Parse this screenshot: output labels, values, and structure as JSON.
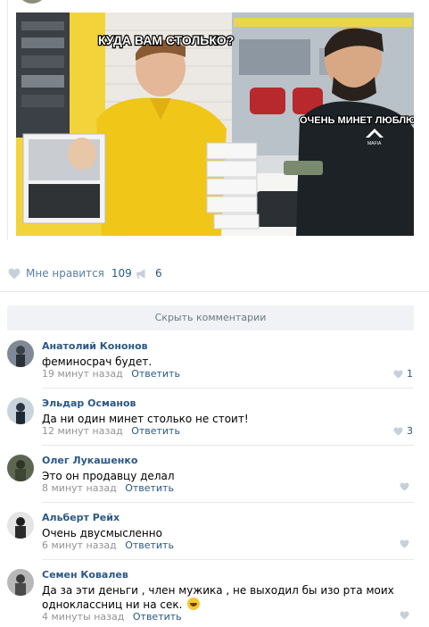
{
  "post": {
    "image_captions": {
      "top": "КУДА ВАМ СТОЛЬКО?",
      "right": "ОЧЕНЬ МИНЕТ ЛЮБЛЮ",
      "brand": "MAFIA"
    }
  },
  "actions": {
    "like_label": "Мне нравится",
    "like_count": "109",
    "share_count": "6"
  },
  "hide_comments_label": "Скрыть комментарии",
  "comments": [
    {
      "author": "Анатолий Кононов",
      "text": "феминосрач будет.",
      "time": "19 минут назад",
      "reply": "Ответить",
      "likes": "1"
    },
    {
      "author": "Эльдар Османов",
      "text": "Да ни один минет столько не стоит!",
      "time": "12 минут назад",
      "reply": "Ответить",
      "likes": "3"
    },
    {
      "author": "Олег Лукашенко",
      "text": "Это он продавцу делал",
      "time": "8 минут назад",
      "reply": "Ответить",
      "likes": ""
    },
    {
      "author": "Альберт Рейх",
      "text": "Очень двусмысленно",
      "time": "6 минут назад",
      "reply": "Ответить",
      "likes": ""
    },
    {
      "author": "Семен Ковалев",
      "text": "Да за эти деньги , член мужика , не выходил бы изо рта моих одноклассниц ни на сек.",
      "time": "4 минуты назад",
      "reply": "Ответить",
      "likes": ""
    }
  ],
  "colors": {
    "link": "#2a5885",
    "meta": "#939393",
    "divider": "#e7e8ec",
    "hide_bar": "#f0f2f5"
  }
}
